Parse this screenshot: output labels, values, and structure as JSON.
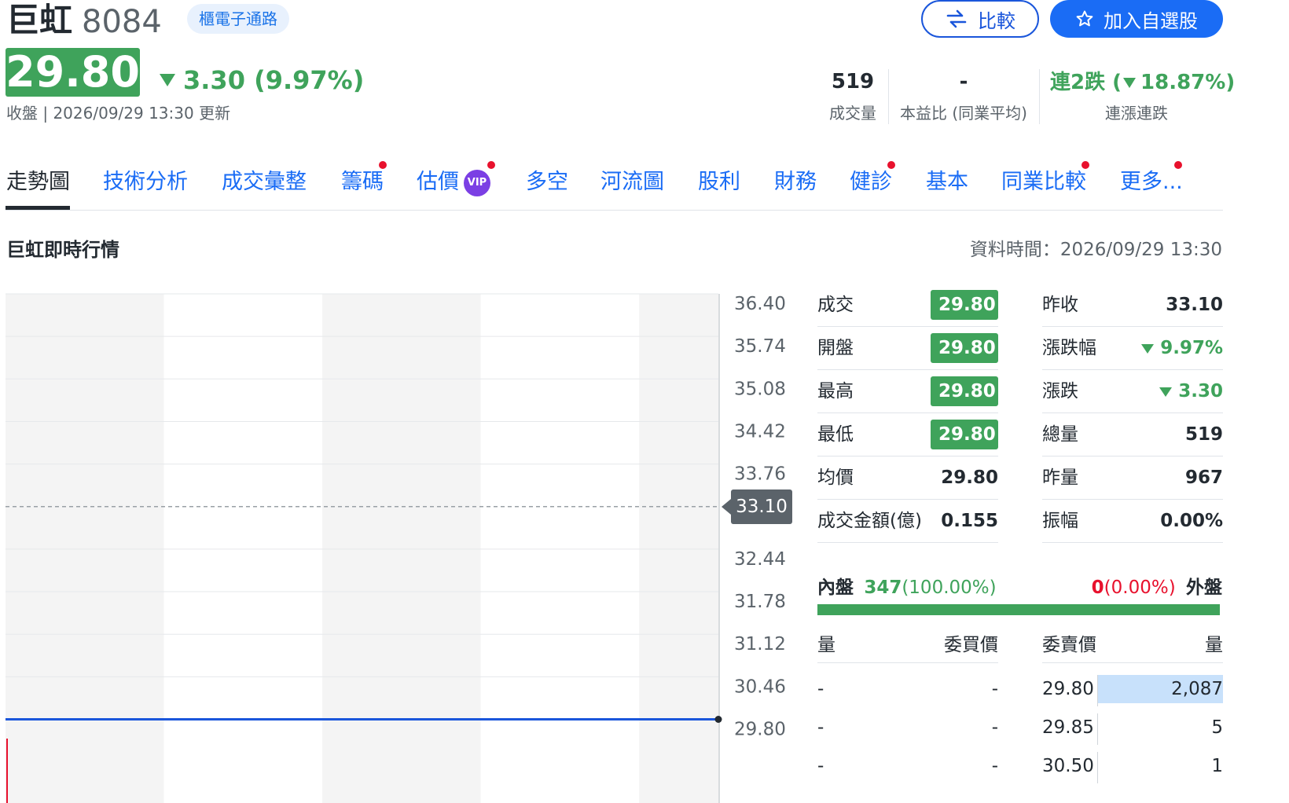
{
  "header": {
    "name": "巨虹",
    "code": "8084",
    "sector": "櫃電子通路",
    "compare_label": "比較",
    "watchlist_label": "加入自選股",
    "price": "29.80",
    "change": "3.30 (9.97%)",
    "update_text": "收盤 | 2026/09/29 13:30 更新",
    "volume_value": "519",
    "volume_label": "成交量",
    "pe_value": "-",
    "pe_label": "本益比 (同業平均)",
    "streak_value_prefix": "連2跌 (",
    "streak_value_pct": "18.87%)",
    "streak_label": "連漲連跌"
  },
  "tabs": [
    {
      "label": "走勢圖"
    },
    {
      "label": "技術分析"
    },
    {
      "label": "成交彙整"
    },
    {
      "label": "籌碼"
    },
    {
      "label": "估價"
    },
    {
      "label": "多空"
    },
    {
      "label": "河流圖"
    },
    {
      "label": "股利"
    },
    {
      "label": "財務"
    },
    {
      "label": "健診"
    },
    {
      "label": "基本"
    },
    {
      "label": "同業比較"
    },
    {
      "label": "更多..."
    }
  ],
  "vip_label": "VIP",
  "section": {
    "title": "巨虹即時行情",
    "data_time": "資料時間：2026/09/29 13:30"
  },
  "chart_data": {
    "type": "line",
    "y_ticks": [
      "36.40",
      "35.74",
      "35.08",
      "34.42",
      "33.76",
      "32.44",
      "31.78",
      "31.12",
      "30.46",
      "29.80"
    ],
    "ylim": [
      29.8,
      36.4
    ],
    "reference_line": {
      "label": "33.10",
      "value": 33.1
    },
    "series": [
      {
        "values": [
          29.8,
          29.8
        ]
      }
    ],
    "grid": true
  },
  "quote": {
    "left": [
      {
        "label": "成交",
        "value": "29.80",
        "badge": true
      },
      {
        "label": "開盤",
        "value": "29.80",
        "badge": true
      },
      {
        "label": "最高",
        "value": "29.80",
        "badge": true
      },
      {
        "label": "最低",
        "value": "29.80",
        "badge": true
      },
      {
        "label": "均價",
        "value": "29.80",
        "badge": false
      },
      {
        "label": "成交金額(億)",
        "value": "0.155",
        "badge": false
      }
    ],
    "right": [
      {
        "label": "昨收",
        "value": "33.10"
      },
      {
        "label": "漲跌幅",
        "value": "9.97%"
      },
      {
        "label": "漲跌",
        "value": "3.30"
      },
      {
        "label": "總量",
        "value": "519"
      },
      {
        "label": "昨量",
        "value": "967"
      },
      {
        "label": "振幅",
        "value": "0.00%"
      }
    ]
  },
  "inner_outer": {
    "inner_label": "內盤",
    "inner_value": "347",
    "inner_pct": "(100.00%)",
    "outer_value": "0",
    "outer_pct": "(0.00%)",
    "outer_label": "外盤",
    "inner_ratio": 1.0
  },
  "order_book": {
    "headers": [
      "量",
      "委買價",
      "委賣價",
      "量"
    ],
    "rows": [
      {
        "bid_vol": "-",
        "bid_price": "-",
        "ask_price": "29.80",
        "ask_vol": "2,087",
        "ask_ratio": 1.0
      },
      {
        "bid_vol": "-",
        "bid_price": "-",
        "ask_price": "29.85",
        "ask_vol": "5",
        "ask_ratio": 0.0
      },
      {
        "bid_vol": "-",
        "bid_price": "-",
        "ask_price": "30.50",
        "ask_vol": "1",
        "ask_ratio": 0.0
      }
    ]
  },
  "colors": {
    "down": "#3fa35b",
    "up": "#e8112d",
    "link": "#1a6cf5",
    "line": "#1a56db"
  }
}
